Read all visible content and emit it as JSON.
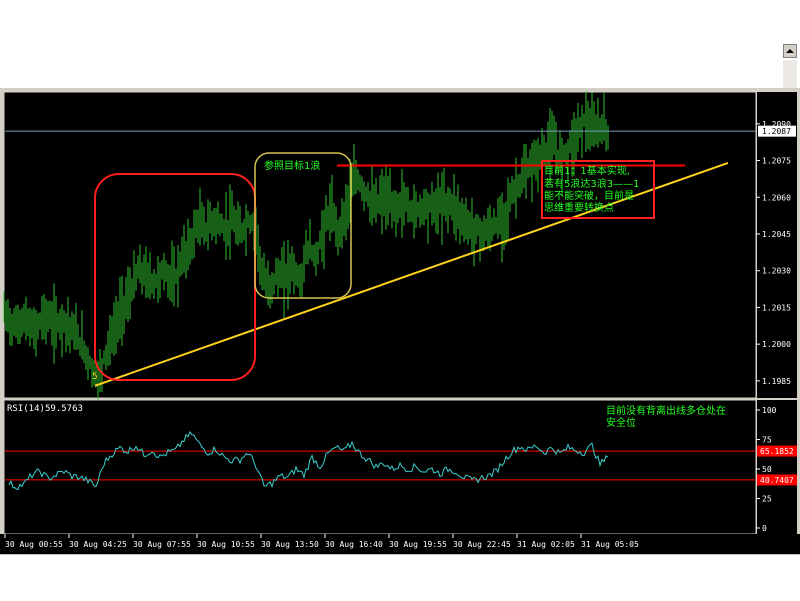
{
  "chart_data": {
    "type": "candlestick",
    "symbol_panel": {
      "ylim": [
        1.1978,
        1.2103
      ],
      "yticks": [
        {
          "value": 1.209,
          "label": "1.2090"
        },
        {
          "value": 1.2075,
          "label": "1.2075"
        },
        {
          "value": 1.206,
          "label": "1.2060"
        },
        {
          "value": 1.2045,
          "label": "1.2045"
        },
        {
          "value": 1.203,
          "label": "1.2030"
        },
        {
          "value": 1.2015,
          "label": "1.2015"
        },
        {
          "value": 1.2,
          "label": "1.2000"
        },
        {
          "value": 1.1985,
          "label": "1.1985"
        }
      ],
      "current_price": 1.2087,
      "current_price_label": "1.2087",
      "price_path": [
        [
          0,
          1.2013
        ],
        [
          10,
          1.2007
        ],
        [
          20,
          1.201
        ],
        [
          30,
          1.2005
        ],
        [
          40,
          1.2012
        ],
        [
          50,
          1.2008
        ],
        [
          60,
          1.201
        ],
        [
          70,
          1.2005
        ],
        [
          80,
          1.1998
        ],
        [
          90,
          1.1988
        ],
        [
          95,
          1.1985
        ],
        [
          100,
          1.1995
        ],
        [
          110,
          1.2005
        ],
        [
          118,
          1.2015
        ],
        [
          126,
          1.202
        ],
        [
          134,
          1.203
        ],
        [
          142,
          1.2028
        ],
        [
          150,
          1.2025
        ],
        [
          160,
          1.203
        ],
        [
          170,
          1.2025
        ],
        [
          178,
          1.2035
        ],
        [
          186,
          1.204
        ],
        [
          194,
          1.205
        ],
        [
          202,
          1.2047
        ],
        [
          210,
          1.2051
        ],
        [
          220,
          1.2047
        ],
        [
          228,
          1.205
        ],
        [
          236,
          1.2045
        ],
        [
          244,
          1.205
        ],
        [
          252,
          1.2048
        ],
        [
          258,
          1.2028
        ],
        [
          264,
          1.2022
        ],
        [
          272,
          1.2028
        ],
        [
          280,
          1.2027
        ],
        [
          288,
          1.2032
        ],
        [
          296,
          1.2025
        ],
        [
          304,
          1.204
        ],
        [
          312,
          1.2035
        ],
        [
          318,
          1.2044
        ],
        [
          326,
          1.2055
        ],
        [
          334,
          1.2046
        ],
        [
          340,
          1.2052
        ],
        [
          346,
          1.2062
        ],
        [
          352,
          1.2068
        ],
        [
          360,
          1.2063
        ],
        [
          370,
          1.2056
        ],
        [
          380,
          1.206
        ],
        [
          390,
          1.2055
        ],
        [
          400,
          1.2058
        ],
        [
          410,
          1.2054
        ],
        [
          420,
          1.2057
        ],
        [
          430,
          1.2056
        ],
        [
          440,
          1.2058
        ],
        [
          450,
          1.2057
        ],
        [
          460,
          1.205
        ],
        [
          470,
          1.2047
        ],
        [
          480,
          1.2045
        ],
        [
          490,
          1.2048
        ],
        [
          500,
          1.2052
        ],
        [
          510,
          1.2063
        ],
        [
          520,
          1.2068
        ],
        [
          530,
          1.2074
        ],
        [
          540,
          1.2078
        ],
        [
          548,
          1.2082
        ],
        [
          556,
          1.2076
        ],
        [
          564,
          1.208
        ],
        [
          572,
          1.2085
        ],
        [
          580,
          1.2092
        ],
        [
          588,
          1.2086
        ],
        [
          596,
          1.2089
        ],
        [
          604,
          1.2087
        ]
      ],
      "horizontal_line": {
        "value": 1.2073,
        "x_start": 337,
        "x_end": 685,
        "color": "#ff0000"
      },
      "trendline": {
        "p1": [
          95,
          1.1983
        ],
        "p2": [
          728,
          1.2074
        ],
        "color": "#ffd21e"
      },
      "arrow_marker_label": "5",
      "annotations": [
        {
          "text": "参照目标1浪"
        },
        {
          "lines": [
            "目前1：1基本实现,",
            "若有5浪达3浪3——1",
            "能不能突破，目前是",
            "思维重要转换点"
          ]
        }
      ]
    },
    "rsi_panel": {
      "label": "RSI(14)",
      "value_label": "59.5763",
      "ylim": [
        0,
        100
      ],
      "yticks": [
        {
          "value": 100,
          "label": "100"
        },
        {
          "value": 75,
          "label": "75"
        },
        {
          "value": 50,
          "label": "50"
        },
        {
          "value": 25,
          "label": "25"
        },
        {
          "value": 0,
          "label": "0"
        }
      ],
      "levels": [
        {
          "value": 65.1852,
          "label": "65.1852",
          "color": "#ff0000"
        },
        {
          "value": 40.7407,
          "label": "40.7407",
          "color": "#ff0000"
        }
      ],
      "rsi_path": [
        [
          5,
          38
        ],
        [
          12,
          35
        ],
        [
          20,
          37
        ],
        [
          28,
          45
        ],
        [
          36,
          48
        ],
        [
          44,
          42
        ],
        [
          52,
          45
        ],
        [
          60,
          48
        ],
        [
          68,
          44
        ],
        [
          76,
          43
        ],
        [
          84,
          40
        ],
        [
          92,
          35
        ],
        [
          100,
          55
        ],
        [
          108,
          63
        ],
        [
          116,
          68
        ],
        [
          124,
          65
        ],
        [
          132,
          70
        ],
        [
          140,
          62
        ],
        [
          148,
          66
        ],
        [
          156,
          60
        ],
        [
          164,
          64
        ],
        [
          172,
          66
        ],
        [
          180,
          75
        ],
        [
          188,
          80
        ],
        [
          196,
          70
        ],
        [
          204,
          64
        ],
        [
          212,
          67
        ],
        [
          220,
          60
        ],
        [
          228,
          57
        ],
        [
          236,
          58
        ],
        [
          244,
          64
        ],
        [
          252,
          53
        ],
        [
          260,
          35
        ],
        [
          268,
          38
        ],
        [
          276,
          44
        ],
        [
          284,
          43
        ],
        [
          292,
          50
        ],
        [
          300,
          45
        ],
        [
          308,
          60
        ],
        [
          316,
          52
        ],
        [
          324,
          63
        ],
        [
          332,
          68
        ],
        [
          340,
          65
        ],
        [
          348,
          72
        ],
        [
          356,
          63
        ],
        [
          364,
          58
        ],
        [
          372,
          52
        ],
        [
          380,
          55
        ],
        [
          388,
          50
        ],
        [
          396,
          53
        ],
        [
          404,
          50
        ],
        [
          412,
          52
        ],
        [
          420,
          48
        ],
        [
          428,
          50
        ],
        [
          436,
          46
        ],
        [
          444,
          50
        ],
        [
          452,
          48
        ],
        [
          460,
          43
        ],
        [
          468,
          40
        ],
        [
          476,
          42
        ],
        [
          484,
          44
        ],
        [
          492,
          48
        ],
        [
          500,
          57
        ],
        [
          508,
          65
        ],
        [
          516,
          69
        ],
        [
          524,
          66
        ],
        [
          532,
          70
        ],
        [
          540,
          64
        ],
        [
          548,
          68
        ],
        [
          556,
          63
        ],
        [
          564,
          68
        ],
        [
          572,
          66
        ],
        [
          580,
          64
        ],
        [
          588,
          70
        ],
        [
          596,
          54
        ],
        [
          604,
          60
        ]
      ],
      "annotation_lines": [
        "目前没有背离出线多仓处在",
        "安全位"
      ]
    },
    "x_ticks": [
      "30 Aug 00:55",
      "30 Aug 04:25",
      "30 Aug 07:55",
      "30 Aug 10:55",
      "30 Aug 13:50",
      "30 Aug 16:40",
      "30 Aug 19:55",
      "30 Aug 22:45",
      "31 Aug 02:05",
      "31 Aug 05:05"
    ]
  }
}
